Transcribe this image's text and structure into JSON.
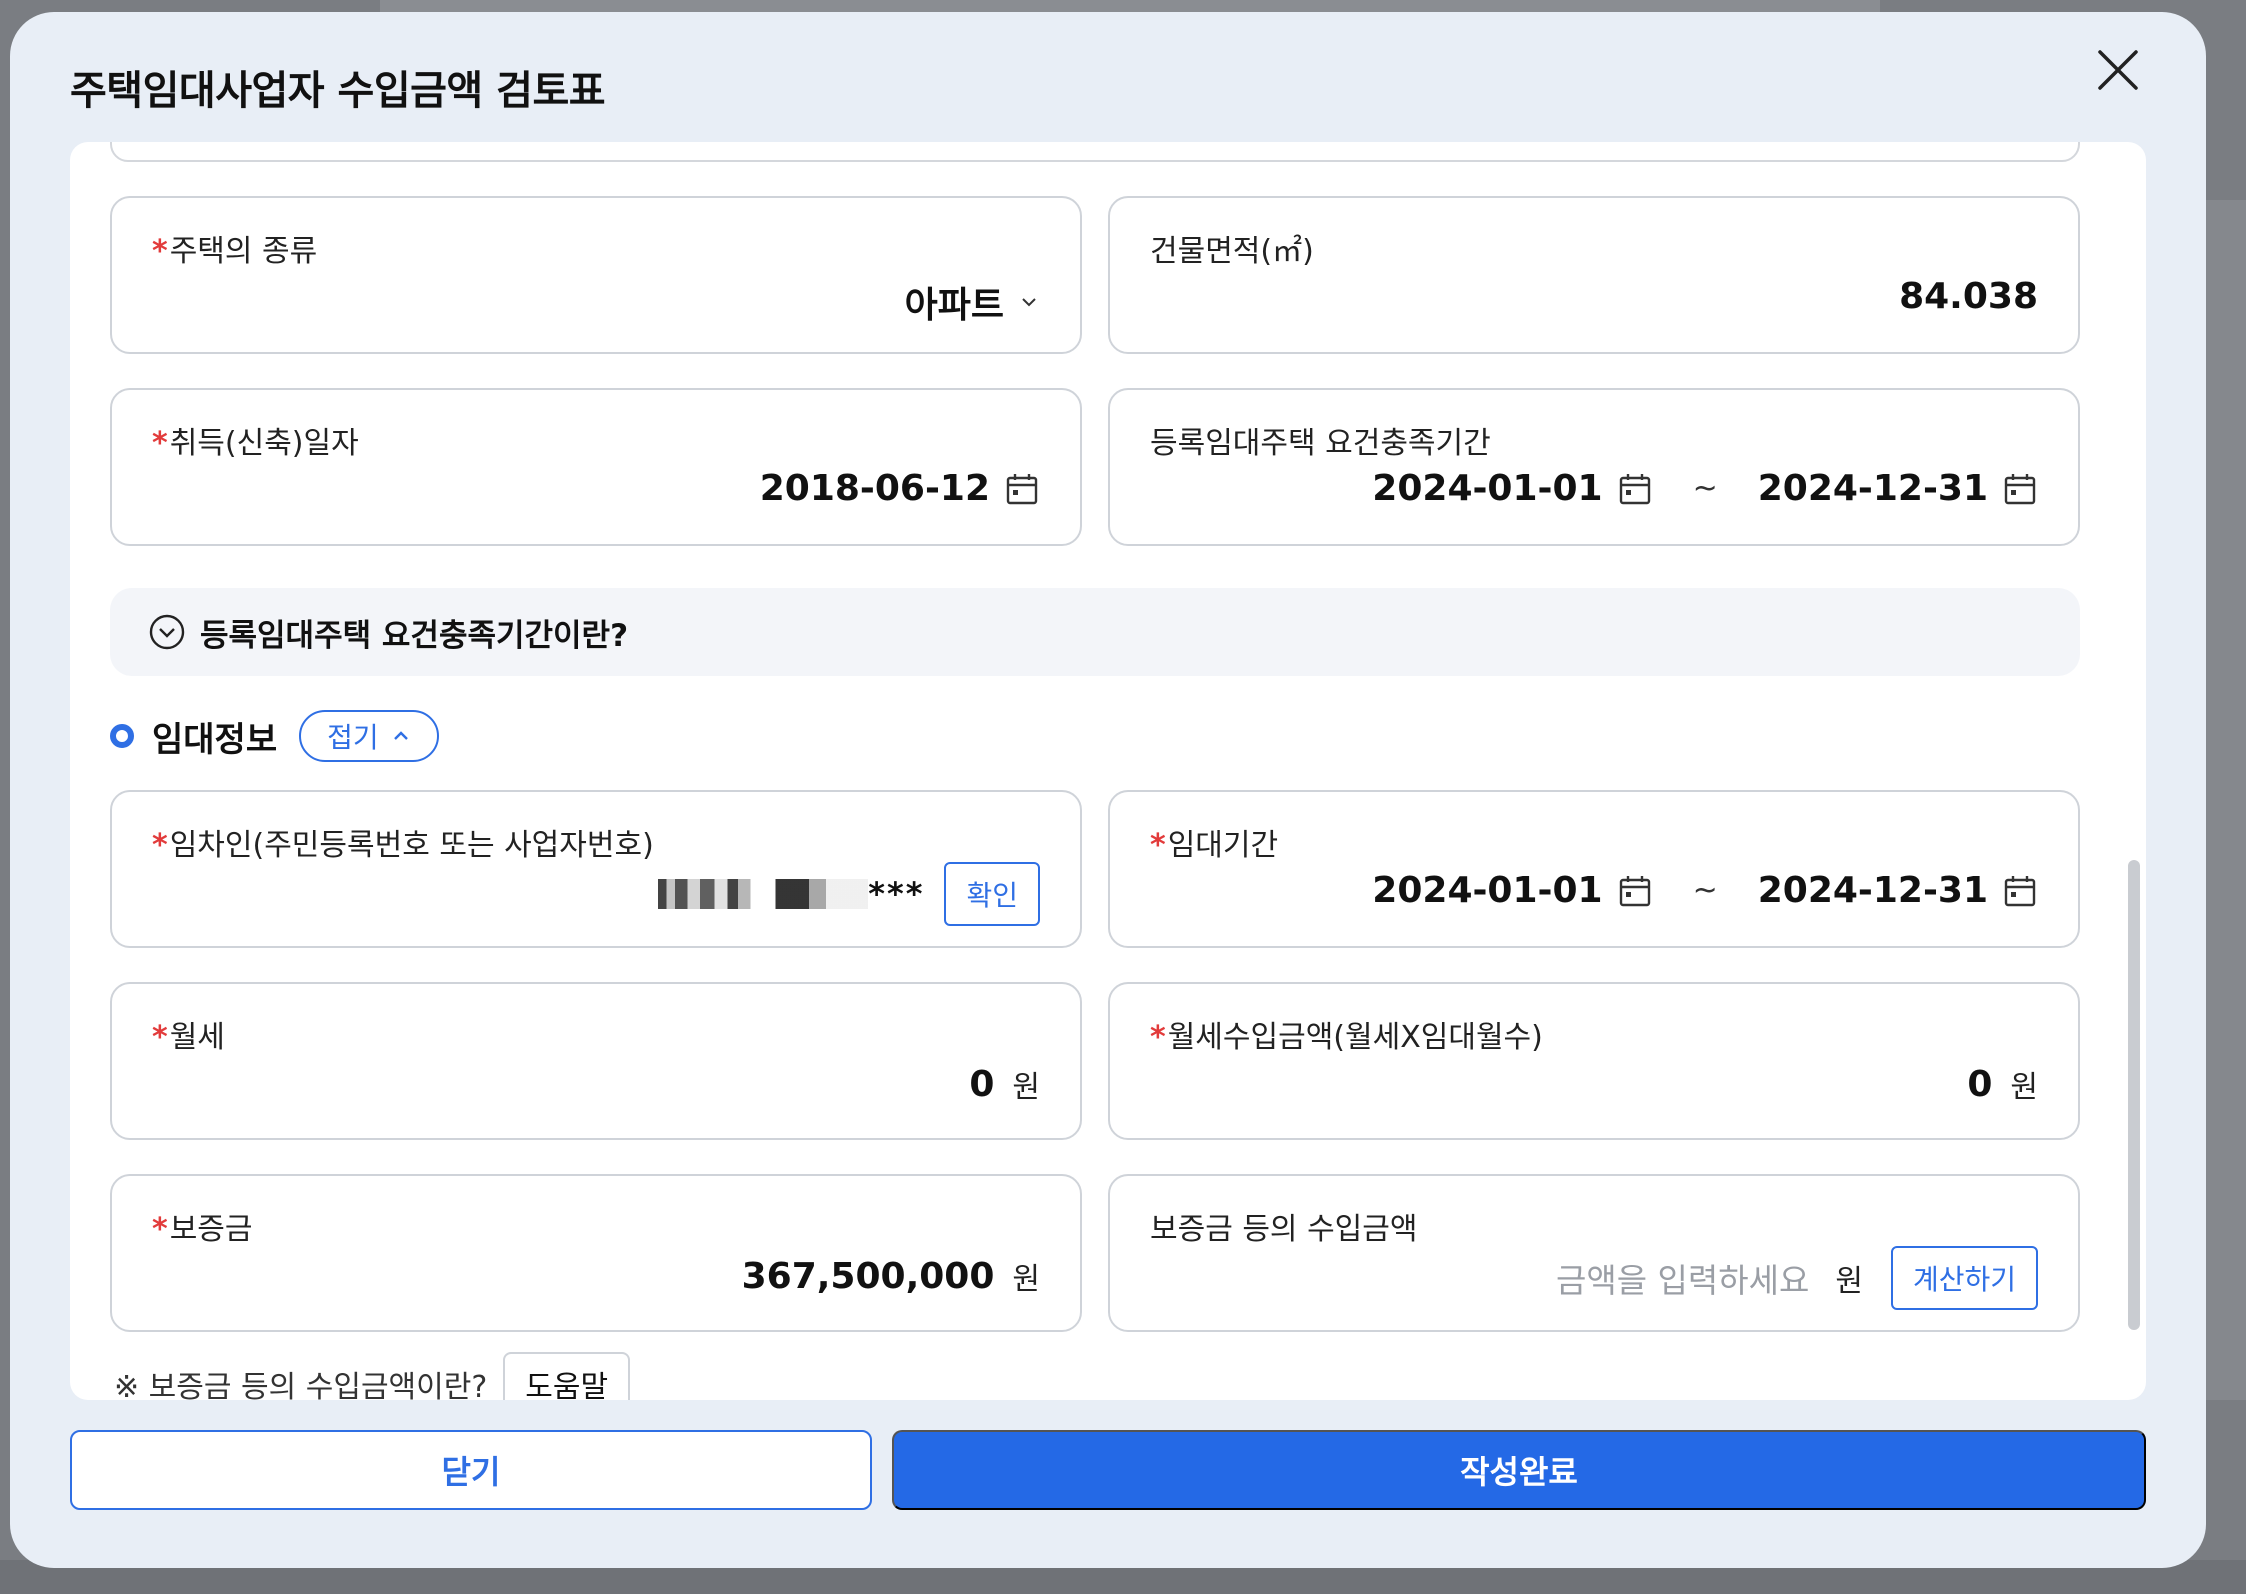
{
  "modal": {
    "title": "주택임대사업자 수입금액 검토표"
  },
  "house_info": {
    "house_type": {
      "label": "주택의 종류",
      "value": "아파트"
    },
    "building_area": {
      "label": "건물면적(㎡)",
      "value": "84.038"
    },
    "acquisition_date": {
      "label": "취득(신축)일자",
      "value": "2018-06-12"
    },
    "requirement_period": {
      "label": "등록임대주택 요건충족기간",
      "start": "2024-01-01",
      "tilde": "~",
      "end": "2024-12-31"
    },
    "info_toggle": "등록임대주택 요건충족기간이란?"
  },
  "lease_section": {
    "title": "임대정보",
    "fold_label": "접기",
    "tenant": {
      "label": "임차인(주민등록번호 또는 사업자번호)",
      "masked_suffix": "***",
      "confirm_label": "확인"
    },
    "lease_period": {
      "label": "임대기간",
      "start": "2024-01-01",
      "tilde": "~",
      "end": "2024-12-31"
    },
    "monthly_rent": {
      "label": "월세",
      "value": "0",
      "unit": "원"
    },
    "monthly_income": {
      "label": "월세수입금액(월세X임대월수)",
      "value": "0",
      "unit": "원"
    },
    "deposit": {
      "label": "보증금",
      "value": "367,500,000",
      "unit": "원"
    },
    "deposit_income": {
      "label": "보증금 등의 수입금액",
      "placeholder": "금액을 입력하세요",
      "unit": "원",
      "calc_label": "계산하기"
    },
    "help_text": "※ 보증금 등의 수입금액이란?",
    "help_label": "도움말"
  },
  "footer": {
    "close_label": "닫기",
    "done_label": "작성완료"
  },
  "colors": {
    "primary": "#2469e6",
    "required": "#e23b3b"
  }
}
